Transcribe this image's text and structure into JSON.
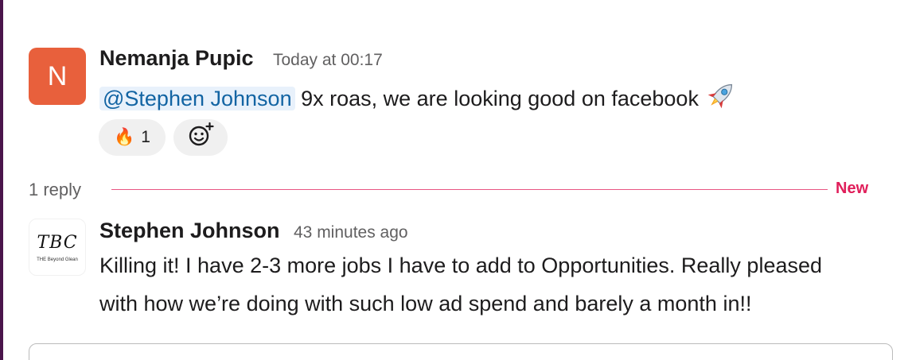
{
  "message1": {
    "avatar_initial": "N",
    "sender": "Nemanja Pupic",
    "timestamp": "Today at 00:17",
    "mention": "@Stephen Johnson",
    "text": "9x roas, we are looking good on facebook",
    "reactions": [
      {
        "emoji": "🔥",
        "count": "1"
      }
    ]
  },
  "thread": {
    "reply_count": "1 reply",
    "new_label": "New"
  },
  "message2": {
    "avatar_logo": "TBC",
    "avatar_subtext": "THE Beyond Glean",
    "sender": "Stephen Johnson",
    "timestamp": "43 minutes ago",
    "line1": "Killing it! I have 2-3 more jobs I have to add to Opportunities. Really pleased",
    "line2": "with how we’re doing with such low ad spend and barely a month in!!"
  },
  "colors": {
    "accent_new": "#e01e5a",
    "mention_bg": "#e8f1fb",
    "mention_text": "#1264a3",
    "avatar_n_bg": "#e8603c",
    "rail": "#4a154b"
  }
}
